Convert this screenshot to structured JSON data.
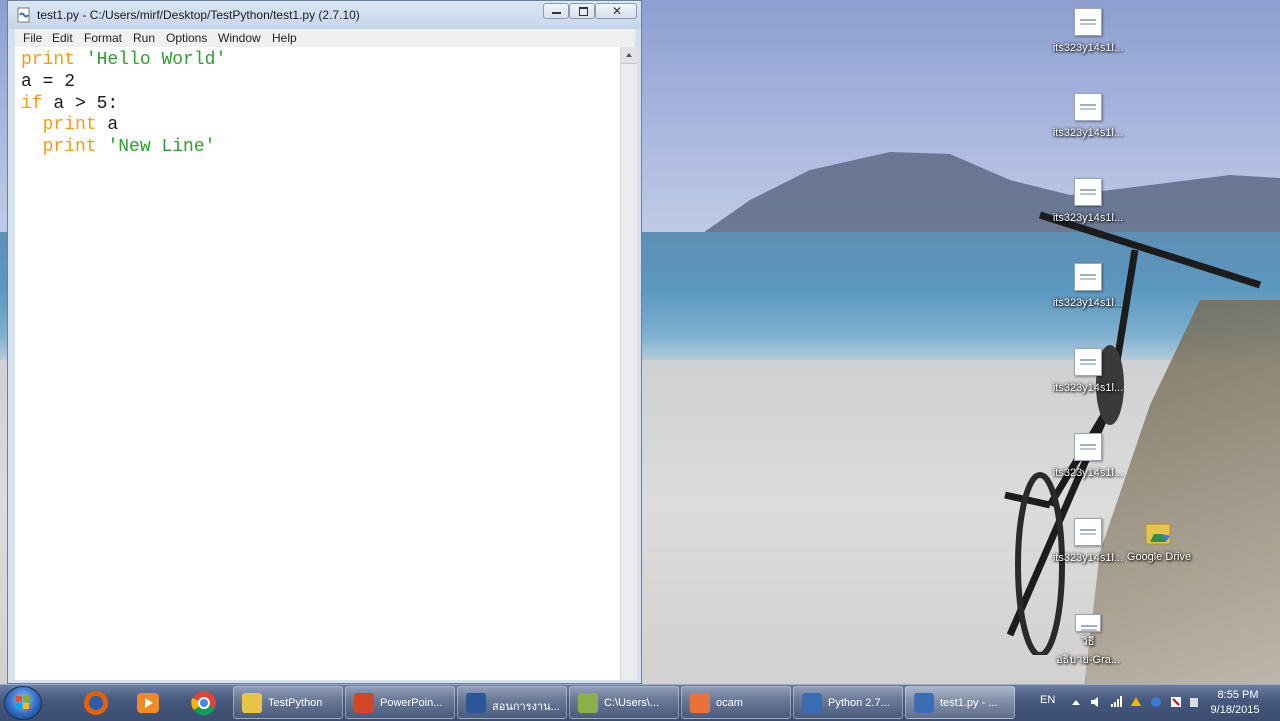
{
  "window": {
    "title": "test1.py - C:/Users/mirf/Desktop/TestPython/test1.py (2.7.10)",
    "menu": [
      "File",
      "Edit",
      "Format",
      "Run",
      "Options",
      "Window",
      "Help"
    ]
  },
  "code": {
    "line1": {
      "kw": "print",
      "str": "'Hello World'"
    },
    "line2": {
      "text": "a = 2"
    },
    "line3": {
      "kw": "if",
      "rest": " a > 5:"
    },
    "line4": {
      "kw": "print",
      "rest": " a"
    },
    "line5": {
      "kw": "print",
      "str": "'New Line'"
    }
  },
  "desktop_icons": [
    "its323y14s1l...",
    "its323y14s1l...",
    "its323y14s1l...",
    "its323y14s1l...",
    "its323y14s1l...",
    "its323y14s1l...",
    "its323y14s1l...",
    "Google Drive",
    "วิธี",
    "อธิบาย-Gra..."
  ],
  "taskbar": {
    "items": [
      "TestPython",
      "PowerPoin...",
      "สอนการงาน...",
      "C:\\Users\\...",
      "ocam",
      "Python 2.7...",
      "test1.py - ..."
    ],
    "language": "EN",
    "time": "8:55 PM",
    "date": "9/18/2015"
  },
  "colors": {
    "keyword": "#f39c12",
    "string": "#2ca02c",
    "taskbar": "#46597e"
  }
}
